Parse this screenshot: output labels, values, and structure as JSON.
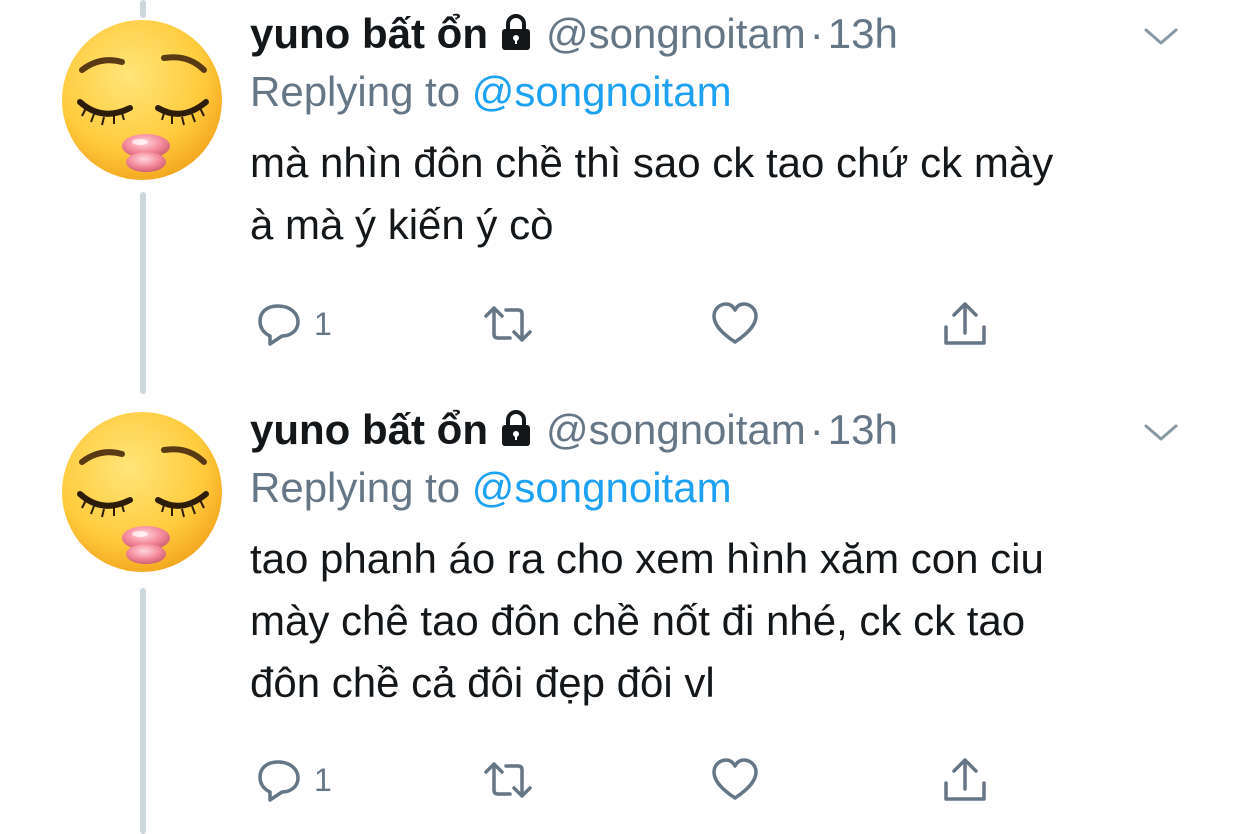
{
  "colors": {
    "text": "#14171a",
    "secondary": "#657786",
    "link": "#1da1f2",
    "thread_line": "#ccd6dd"
  },
  "tweets": [
    {
      "name": "yuno bất ổn",
      "lock_icon": "lock-icon",
      "handle": "@songnoitam",
      "separator": "·",
      "time": "13h",
      "replying_prefix": "Replying to",
      "replying_to": "@songnoitam",
      "text_lines": [
        "mà nhìn đôn chề thì sao ck tao chứ ck mày",
        "à mà ý kiến ý cò"
      ],
      "reply_count": "1",
      "icons": [
        "reply-icon",
        "retweet-icon",
        "like-icon",
        "share-icon",
        "chevron-down-icon"
      ]
    },
    {
      "name": "yuno bất ổn",
      "lock_icon": "lock-icon",
      "handle": "@songnoitam",
      "separator": "·",
      "time": "13h",
      "replying_prefix": "Replying to",
      "replying_to": "@songnoitam",
      "text_lines": [
        "tao phanh áo ra cho xem hình xăm con ciu",
        "mày chê tao đôn chề nốt đi nhé, ck ck tao",
        "đôn chề cả đôi đẹp đôi vl"
      ],
      "reply_count": "1",
      "icons": [
        "reply-icon",
        "retweet-icon",
        "like-icon",
        "share-icon",
        "chevron-down-icon"
      ]
    }
  ]
}
